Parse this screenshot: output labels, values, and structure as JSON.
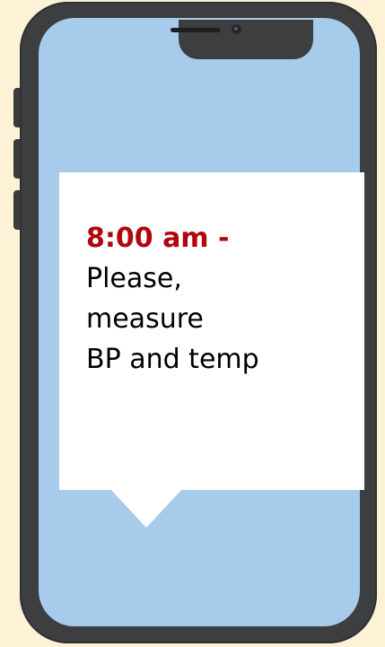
{
  "notification": {
    "time": "8:00 am -",
    "lines": [
      "Please,",
      "measure",
      "BP and temp"
    ]
  },
  "colors": {
    "page_background": "#fdf1d6",
    "phone_frame": "#3d3e40",
    "screen": "#a7cbea",
    "bubble": "#ffffff",
    "time_text": "#b0060e"
  },
  "icons": [
    "speaker-icon",
    "camera-icon"
  ]
}
